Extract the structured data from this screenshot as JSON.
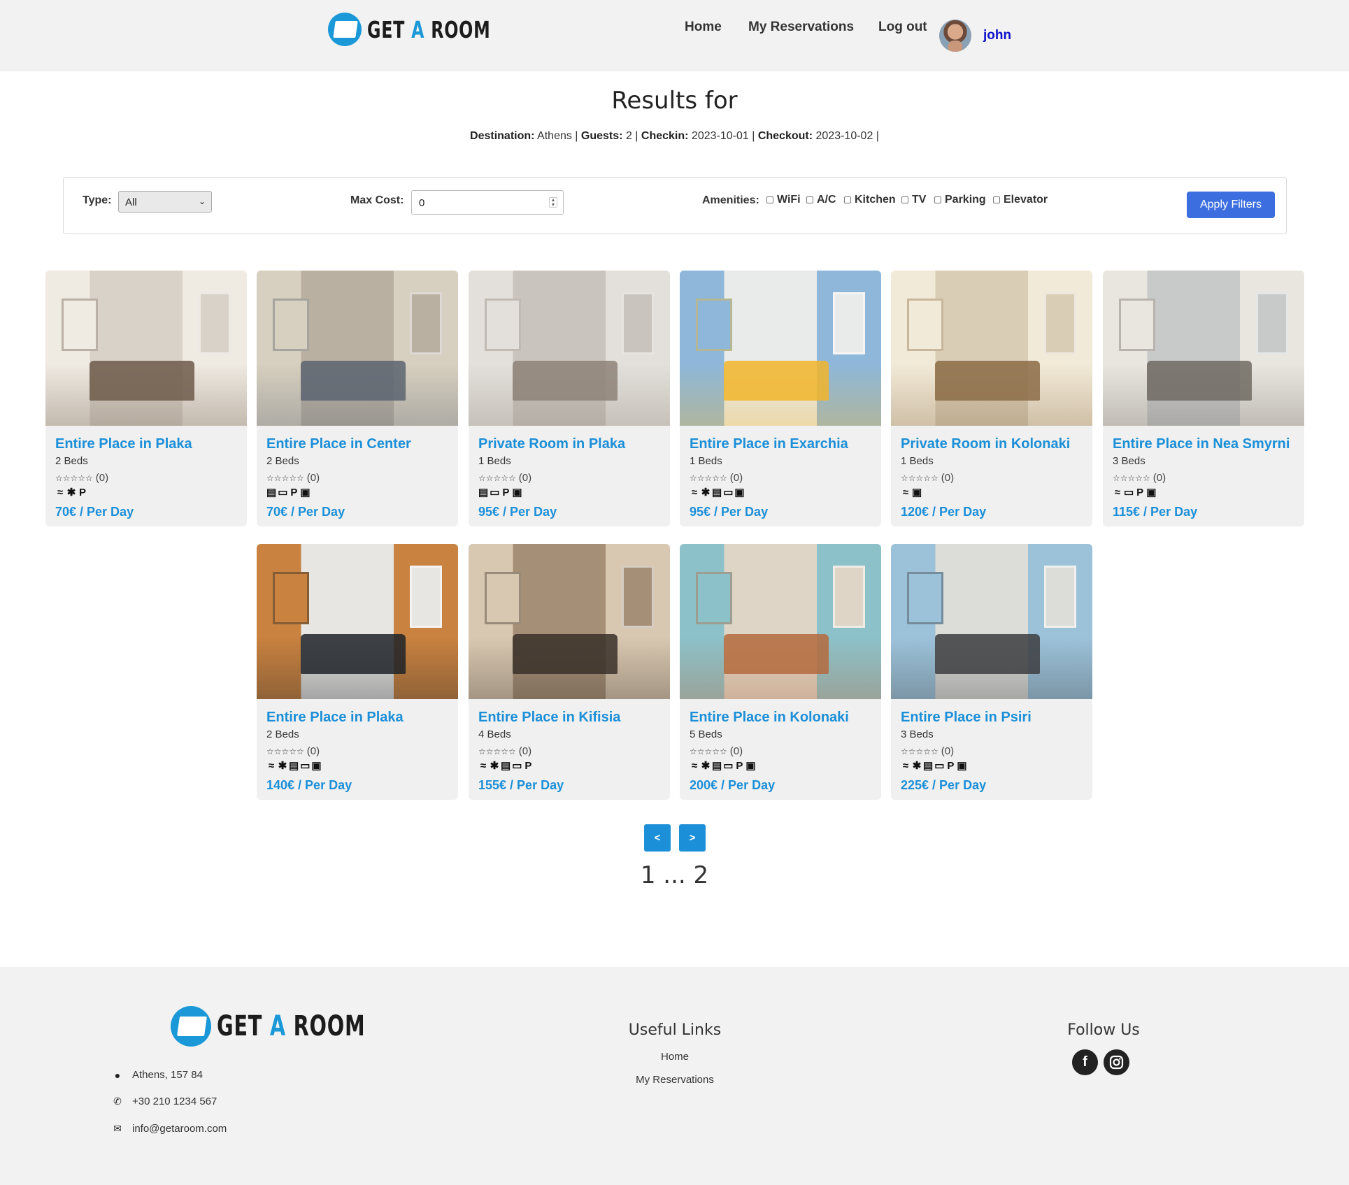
{
  "header": {
    "logo_text": "GET",
    "logo_a": "A",
    "logo_room": "ROOM",
    "nav": [
      "Home",
      "My Reservations",
      "Log out"
    ],
    "username": "john"
  },
  "results": {
    "title": "Results for",
    "destination_label": "Destination:",
    "destination": "Athens",
    "guests_label": "Guests:",
    "guests": "2",
    "checkin_label": "Checkin:",
    "checkin": "2023-10-01",
    "checkout_label": "Checkout:",
    "checkout": "2023-10-02"
  },
  "filters": {
    "type_label": "Type:",
    "type_value": "All",
    "max_cost_label": "Max Cost:",
    "max_cost_value": "0",
    "amenities_label": "Amenities:",
    "amenities": [
      "WiFi",
      "A/C",
      "Kitchen",
      "TV",
      "Parking",
      "Elevator"
    ],
    "apply_label": "Apply Filters"
  },
  "listings": [
    {
      "title": "Entire Place in Plaka",
      "beds": "2 Beds",
      "rating": "(0)",
      "amenity_icons": [
        "wifi-icon",
        "ac-icon",
        "parking-icon"
      ],
      "price": "70€ / Per Day",
      "colors": [
        "#d8d2c8",
        "#6d5a4a",
        "#efeae2"
      ]
    },
    {
      "title": "Entire Place in Center",
      "beds": "2 Beds",
      "rating": "(0)",
      "amenity_icons": [
        "kitchen-icon",
        "tv-icon",
        "parking-icon",
        "elevator-icon"
      ],
      "price": "70€ / Per Day",
      "colors": [
        "#b9b0a2",
        "#5b6470",
        "#d7cfbf"
      ]
    },
    {
      "title": "Private Room in Plaka",
      "beds": "1 Beds",
      "rating": "(0)",
      "amenity_icons": [
        "kitchen-icon",
        "tv-icon",
        "parking-icon",
        "elevator-icon"
      ],
      "price": "95€ / Per Day",
      "colors": [
        "#c9c4bd",
        "#8d8378",
        "#e3e0db"
      ]
    },
    {
      "title": "Entire Place in Exarchia",
      "beds": "1 Beds",
      "rating": "(0)",
      "amenity_icons": [
        "wifi-icon",
        "ac-icon",
        "kitchen-icon",
        "tv-icon",
        "elevator-icon"
      ],
      "price": "95€ / Per Day",
      "colors": [
        "#e9eaea",
        "#f1b52a",
        "#8eb7da"
      ]
    },
    {
      "title": "Private Room in Kolonaki",
      "beds": "1 Beds",
      "rating": "(0)",
      "amenity_icons": [
        "wifi-icon",
        "elevator-icon"
      ],
      "price": "120€ / Per Day",
      "colors": [
        "#d9cdb6",
        "#8b6b45",
        "#f2ead8"
      ]
    },
    {
      "title": "Entire Place in Nea Smyrni",
      "beds": "3 Beds",
      "rating": "(0)",
      "amenity_icons": [
        "wifi-icon",
        "tv-icon",
        "parking-icon",
        "elevator-icon"
      ],
      "price": "115€ / Per Day",
      "colors": [
        "#c8c9c9",
        "#6f6a61",
        "#e9e6e0"
      ]
    },
    {
      "title": "Entire Place in Plaka",
      "beds": "2 Beds",
      "rating": "(0)",
      "amenity_icons": [
        "wifi-icon",
        "ac-icon",
        "kitchen-icon",
        "tv-icon",
        "elevator-icon"
      ],
      "price": "140€ / Per Day",
      "colors": [
        "#e7e6e3",
        "#1e2228",
        "#c9823f"
      ]
    },
    {
      "title": "Entire Place in Kifisia",
      "beds": "4 Beds",
      "rating": "(0)",
      "amenity_icons": [
        "wifi-icon",
        "ac-icon",
        "kitchen-icon",
        "tv-icon",
        "parking-icon"
      ],
      "price": "155€ / Per Day",
      "colors": [
        "#a58f76",
        "#3a3029",
        "#d9c8b1"
      ]
    },
    {
      "title": "Entire Place in Kolonaki",
      "beds": "5 Beds",
      "rating": "(0)",
      "amenity_icons": [
        "wifi-icon",
        "ac-icon",
        "kitchen-icon",
        "tv-icon",
        "parking-icon",
        "elevator-icon"
      ],
      "price": "200€ / Per Day",
      "colors": [
        "#ded5c7",
        "#b46a3c",
        "#8cc1c9"
      ]
    },
    {
      "title": "Entire Place in Psiri",
      "beds": "3 Beds",
      "rating": "(0)",
      "amenity_icons": [
        "wifi-icon",
        "ac-icon",
        "kitchen-icon",
        "tv-icon",
        "parking-icon",
        "elevator-icon"
      ],
      "price": "225€ / Per Day",
      "colors": [
        "#dcdcd8",
        "#3c3d3f",
        "#9cc2da"
      ]
    }
  ],
  "pagination": {
    "prev_label": "<",
    "next_label": ">",
    "pages_text": "1 ... 2"
  },
  "footer": {
    "address": "Athens, 157 84",
    "phone": "+30 210 1234 567",
    "email": "info@getaroom.com",
    "useful_links_heading": "Useful Links",
    "links": [
      "Home",
      "My Reservations"
    ],
    "follow_heading": "Follow Us",
    "social": [
      "facebook-icon",
      "instagram-icon"
    ]
  },
  "colors": {
    "accent": "#1b8fd8",
    "button": "#3c6ee0",
    "username": "#1010cc"
  }
}
